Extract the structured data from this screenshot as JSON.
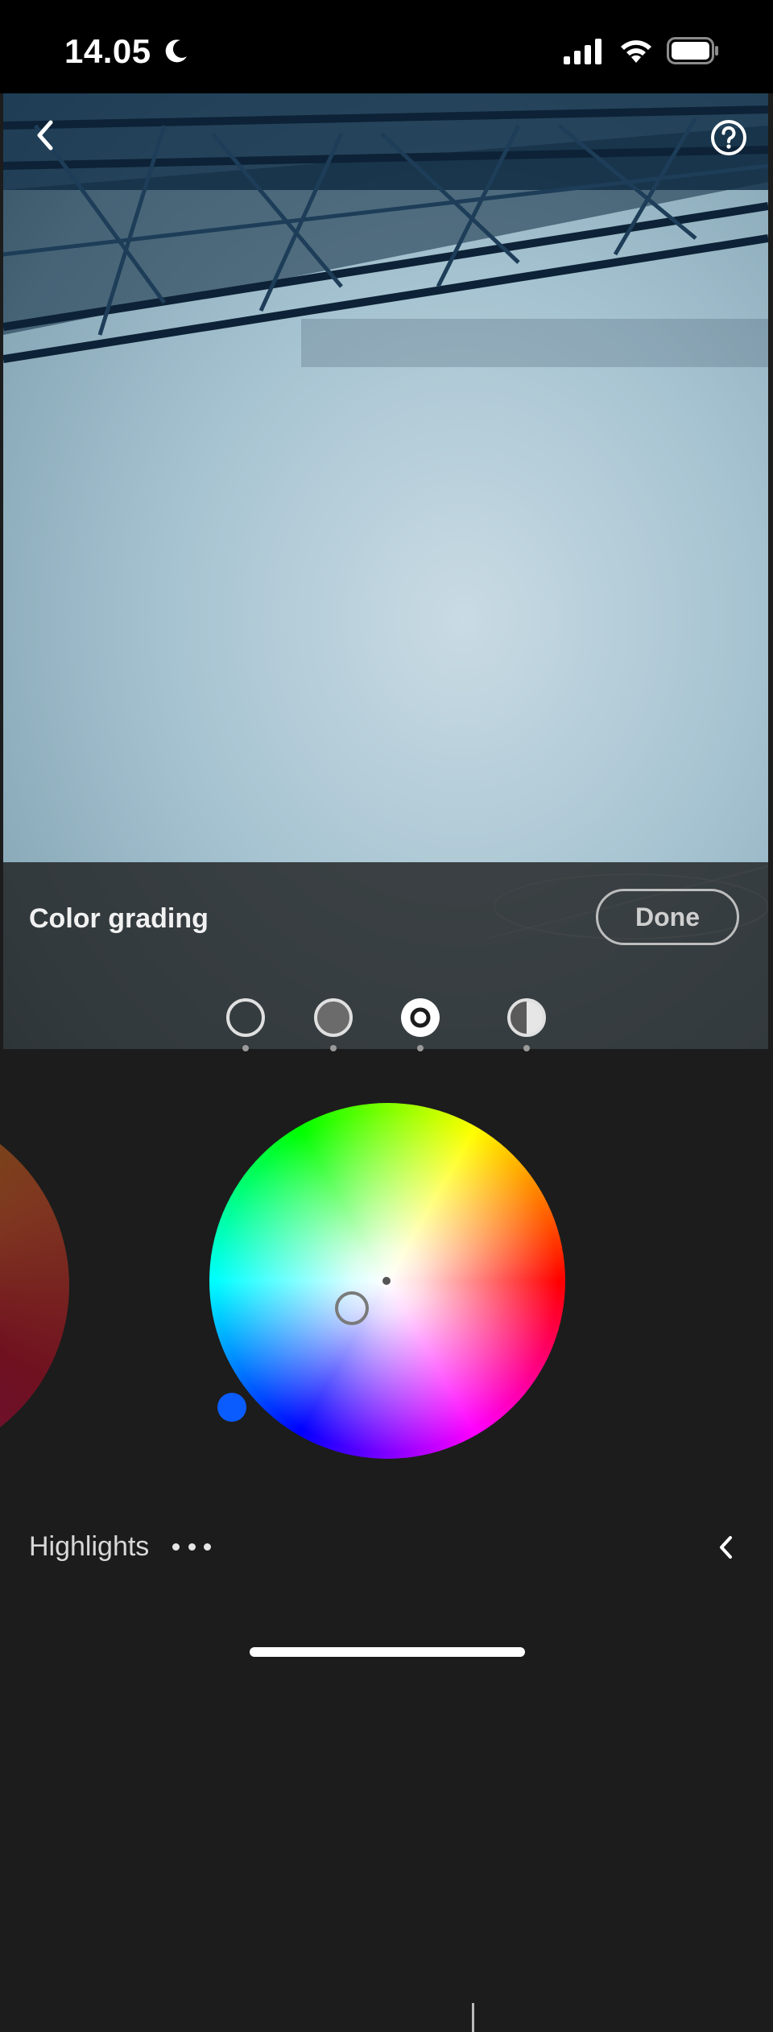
{
  "status_bar": {
    "time": "14.05",
    "icons": [
      "moon-icon",
      "signal-icon",
      "wifi-icon",
      "battery-icon"
    ]
  },
  "toolbar": {
    "back_icon": "chevron-left-icon",
    "help_icon": "question-circle-icon"
  },
  "panel": {
    "title": "Color grading",
    "done_label": "Done",
    "tabs": [
      {
        "name": "shadows",
        "icon": "circle-outline-icon",
        "selected": false
      },
      {
        "name": "midtones",
        "icon": "circle-gray-icon",
        "selected": false
      },
      {
        "name": "highlights",
        "icon": "circle-ring-filled-icon",
        "selected": true
      },
      {
        "name": "global",
        "icon": "half-circle-icon",
        "selected": false
      }
    ]
  },
  "wheel": {
    "accent_knob_color": "#0a5cff"
  },
  "footer": {
    "label": "Highlights",
    "more_icon": "more-dots-icon",
    "collapse_icon": "chevron-left-icon"
  }
}
